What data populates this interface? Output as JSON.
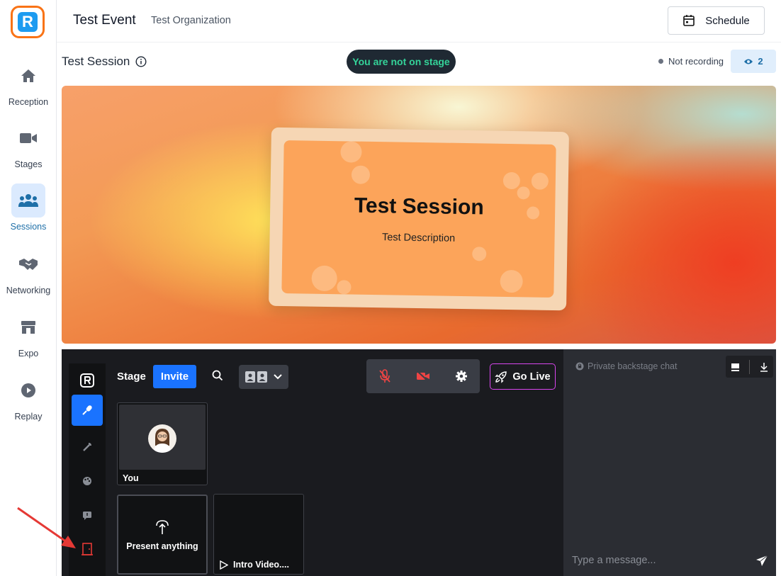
{
  "nav": {
    "items": [
      {
        "label": "Reception",
        "icon": "home-icon"
      },
      {
        "label": "Stages",
        "icon": "video-camera-icon"
      },
      {
        "label": "Sessions",
        "icon": "people-group-icon",
        "active": true
      },
      {
        "label": "Networking",
        "icon": "handshake-icon"
      },
      {
        "label": "Expo",
        "icon": "store-icon"
      },
      {
        "label": "Replay",
        "icon": "play-circle-icon"
      }
    ]
  },
  "header": {
    "event_title": "Test Event",
    "organization": "Test Organization",
    "schedule_label": "Schedule"
  },
  "session": {
    "title": "Test Session",
    "stage_status": "You are not on stage",
    "recording_status": "Not recording",
    "viewer_count": "2"
  },
  "banner": {
    "title": "Test Session",
    "description": "Test Description"
  },
  "backstage": {
    "stage_label": "Stage",
    "invite_label": "Invite",
    "go_live_label": "Go Live",
    "tiles": {
      "you_label": "You",
      "present_label": "Present anything",
      "video_label": "Intro Video...."
    },
    "chat": {
      "placeholder_title": "Private backstage chat",
      "input_placeholder": "Type a message..."
    }
  },
  "colors": {
    "accent": "#1a73ff",
    "stage_status_text": "#34d399",
    "go_live_border": "#d946ef",
    "annotation_arrow": "#e53935"
  }
}
